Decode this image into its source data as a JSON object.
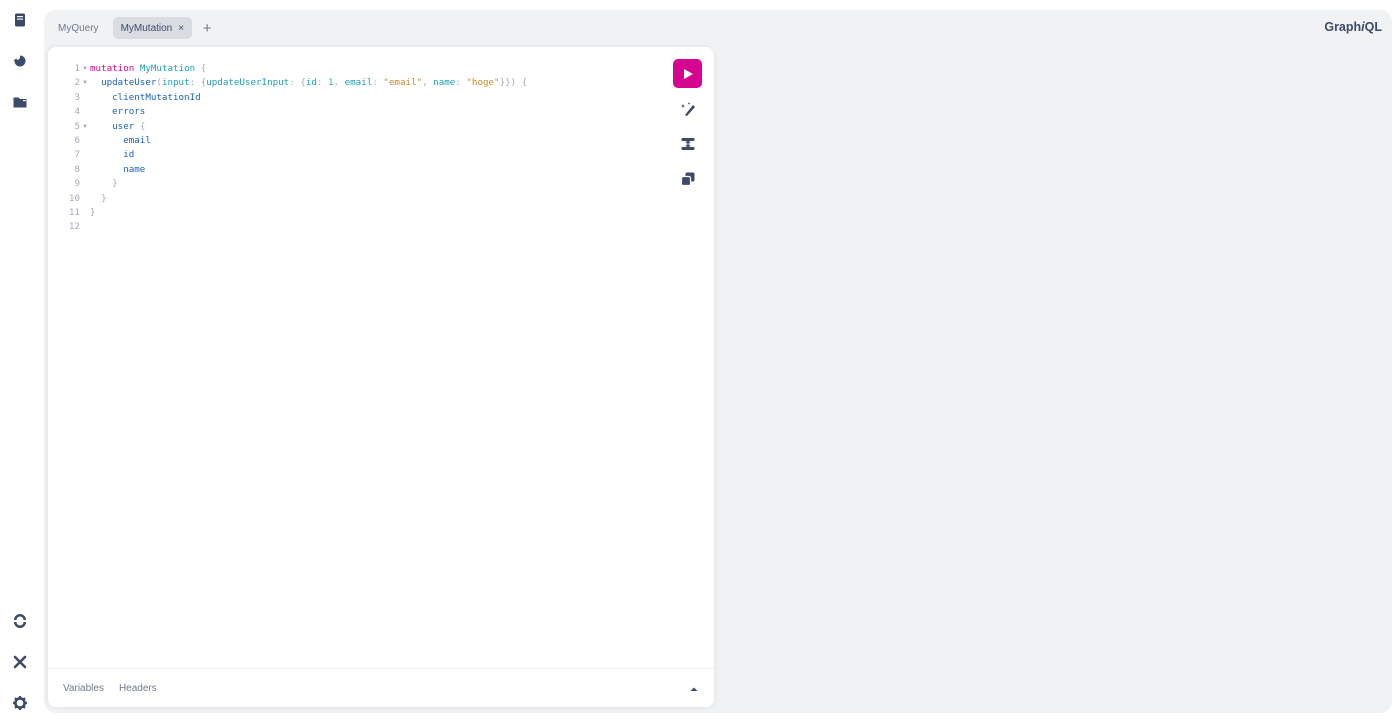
{
  "tabs": [
    {
      "label": "MyQuery",
      "active": false
    },
    {
      "label": "MyMutation",
      "active": true
    }
  ],
  "tab_close_glyph": "×",
  "tab_add_glyph": "+",
  "logo": {
    "prefix": "Graph",
    "italic": "i",
    "suffix": "QL"
  },
  "sidebar_icons": [
    "docs-icon",
    "history-icon",
    "explorer-icon",
    "refetch-schema-icon",
    "shortcuts-icon",
    "settings-icon"
  ],
  "editor_line_numbers": [
    "1",
    "2",
    "3",
    "4",
    "5",
    "6",
    "7",
    "8",
    "9",
    "10",
    "11",
    "12"
  ],
  "editor_tokens": {
    "l1_kw": "mutation",
    "l1_name": "MyMutation",
    "l1_brace": " {",
    "l2_field": "updateUser",
    "l2_p1": "(",
    "l2_arg": "input",
    "l2_p2": ": {",
    "l2_arg2": "updateUserInput",
    "l2_p3": ": {",
    "l2_id": "id",
    "l2_p4": ": ",
    "l2_num": "1",
    "l2_p5": ", ",
    "l2_email": "email",
    "l2_p6": ": ",
    "l2_str1": "\"email\"",
    "l2_p7": ", ",
    "l2_name": "name",
    "l2_p8": ": ",
    "l2_str2": "\"hoge\"",
    "l2_p9": "}}) {",
    "l3": "clientMutationId",
    "l4": "errors",
    "l5": "user",
    "l5_brace": " {",
    "l6": "email",
    "l7": "id",
    "l8": "name",
    "l9": "}",
    "l10": "}",
    "l11": "}"
  },
  "bottom_tabs": [
    "Variables",
    "Headers"
  ],
  "colors": {
    "accent": "#d60590",
    "bg": "#f1f2f4",
    "text": "#3b4b68"
  }
}
